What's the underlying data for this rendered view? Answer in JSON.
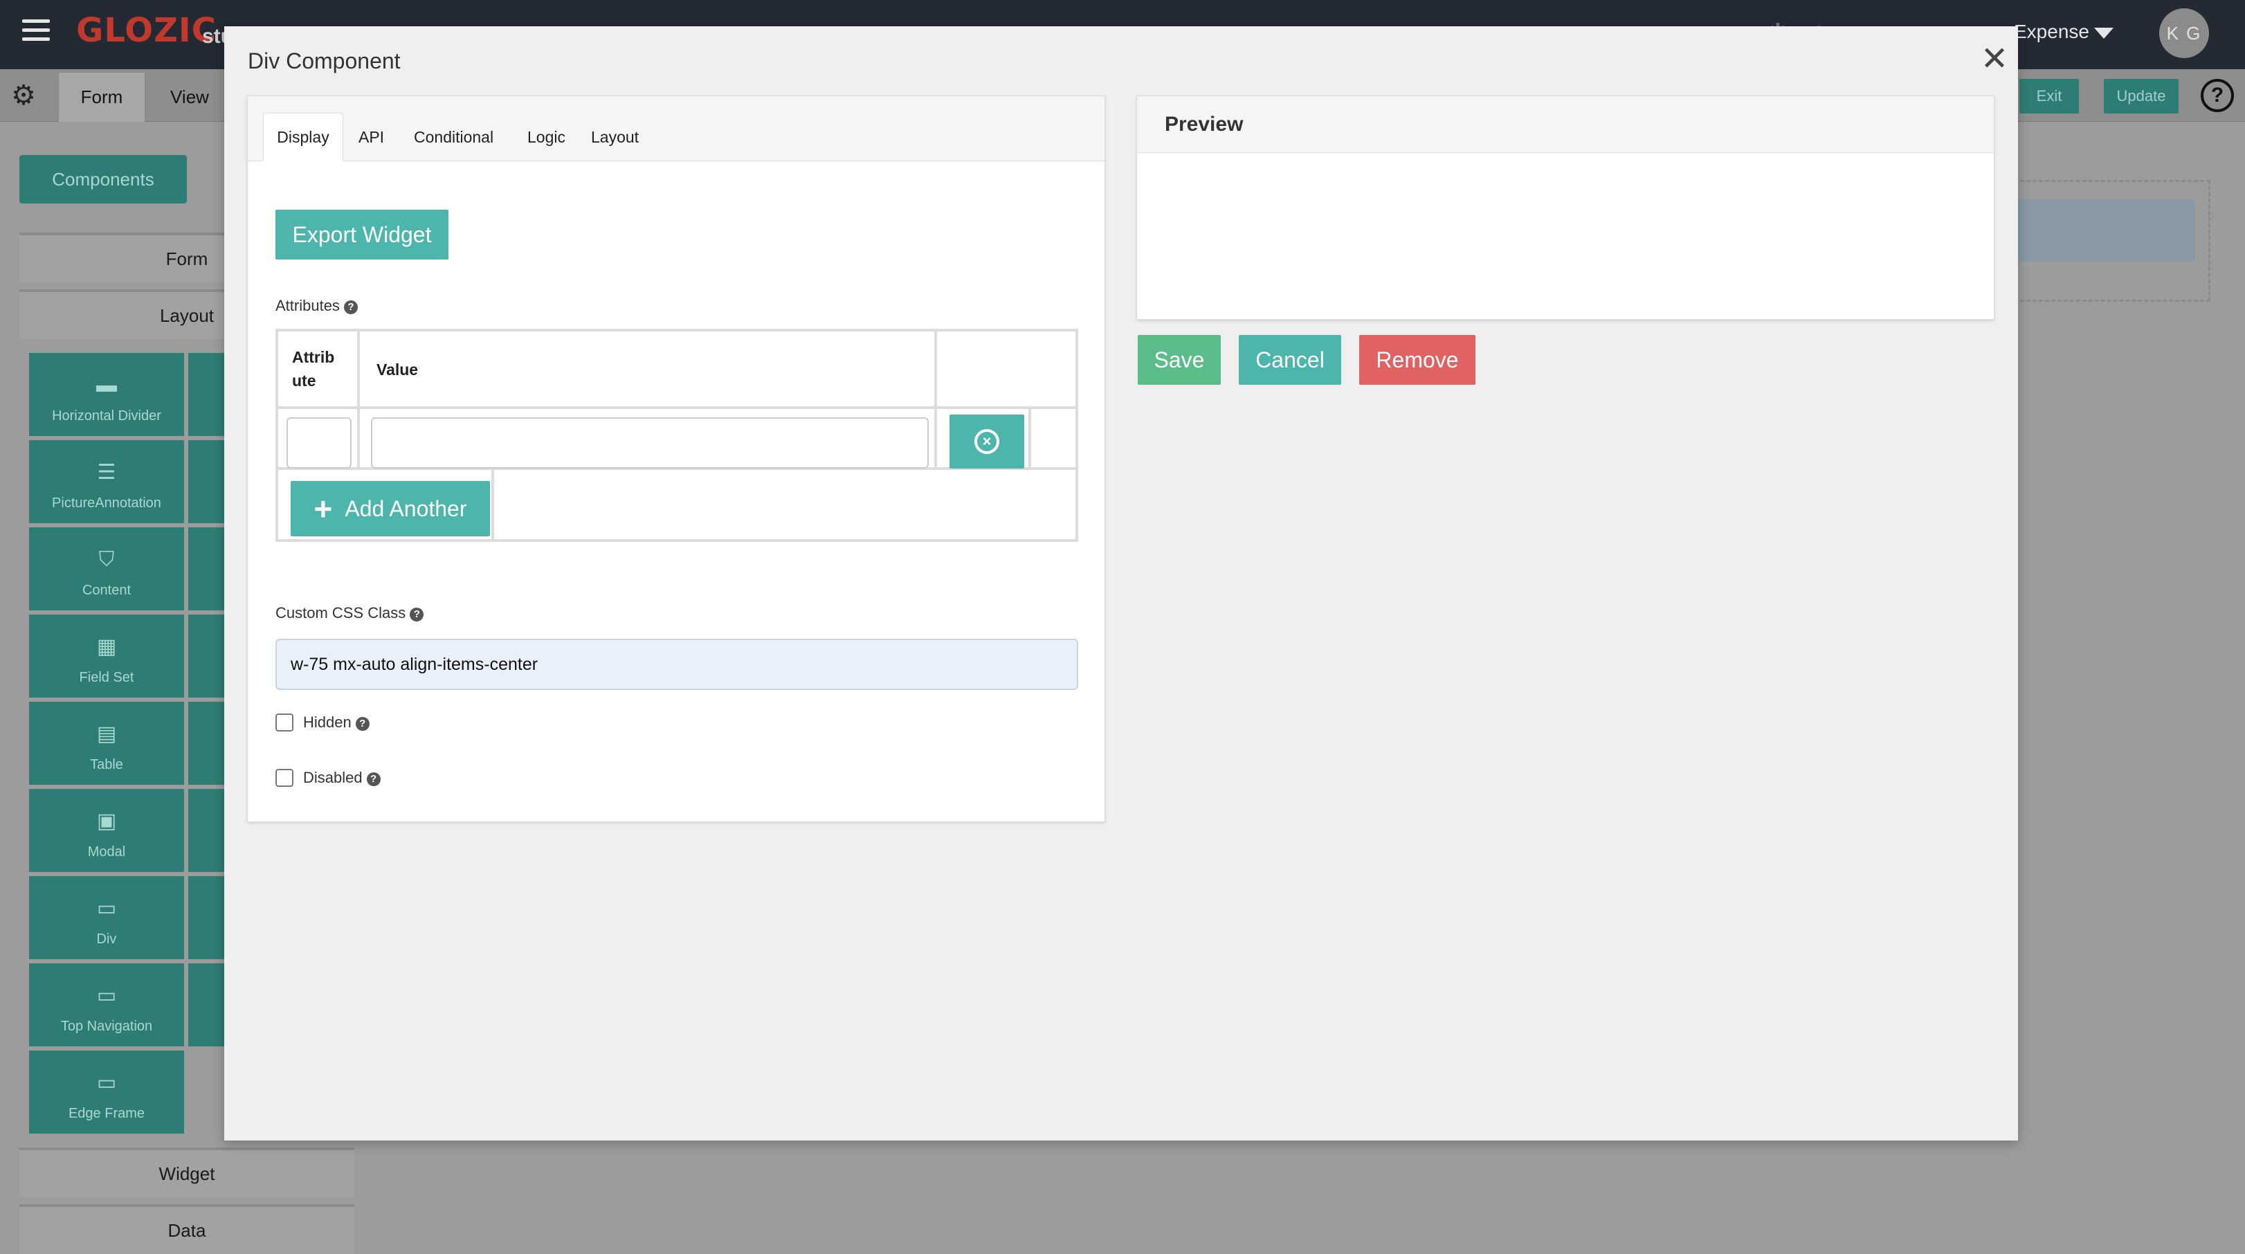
{
  "app": {
    "logo": "GLOZIC",
    "logo_sub": "stu",
    "app_selector": "Expense",
    "avatar_initials": "K G"
  },
  "builder": {
    "tabs": [
      {
        "label": "Form"
      },
      {
        "label": "View"
      }
    ],
    "exit_label": "Exit",
    "update_label": "Update",
    "help_glyph": "?"
  },
  "sidebar": {
    "components_label": "Components",
    "sections": [
      {
        "label": "Form"
      },
      {
        "label": "Layout"
      },
      {
        "label": "Widget"
      },
      {
        "label": "Data"
      }
    ],
    "tiles": [
      {
        "label": "Horizontal Divider",
        "icon": "minus-icon"
      },
      {
        "label": "PictureAnnotation",
        "icon": "bars-icon"
      },
      {
        "label": "Content",
        "icon": "html5-icon"
      },
      {
        "label": "Field Set",
        "icon": "grid-icon"
      },
      {
        "label": "Table",
        "icon": "table-icon"
      },
      {
        "label": "Modal",
        "icon": "window-icon"
      },
      {
        "label": "Div",
        "icon": "card-icon"
      },
      {
        "label": "Top Navigation",
        "icon": "card-icon"
      },
      {
        "label": "Edge Frame",
        "icon": "card-icon"
      }
    ]
  },
  "modal": {
    "title": "Div Component",
    "close_glyph": "✕",
    "tabs": [
      {
        "label": "Display"
      },
      {
        "label": "API"
      },
      {
        "label": "Conditional"
      },
      {
        "label": "Logic"
      },
      {
        "label": "Layout"
      }
    ],
    "active_tab": "Display",
    "export_label": "Export Widget",
    "attributes": {
      "label": "Attributes",
      "col_attr": "Attrib ute",
      "col_value": "Value",
      "attr_value": "",
      "value_value": "",
      "add_label": "Add Another"
    },
    "css": {
      "label": "Custom CSS Class",
      "value": "w-75 mx-auto align-items-center"
    },
    "hidden_label": "Hidden",
    "disabled_label": "Disabled",
    "preview_title": "Preview",
    "save_label": "Save",
    "cancel_label": "Cancel",
    "remove_label": "Remove"
  }
}
